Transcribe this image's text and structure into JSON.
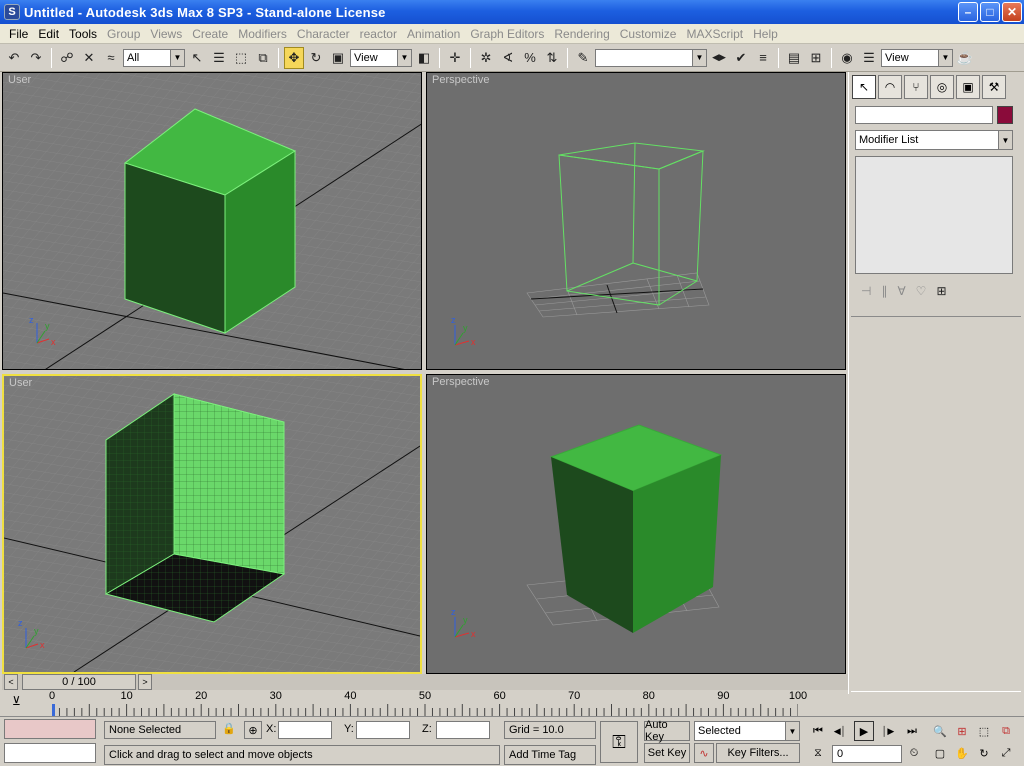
{
  "window": {
    "title": "Untitled  - Autodesk 3ds Max 8 SP3  - Stand-alone License",
    "app_icon": "3ds-max-icon",
    "minimize_glyph": "–",
    "maximize_glyph": "□",
    "close_glyph": "✕"
  },
  "menu": [
    {
      "label": "File",
      "dim": false
    },
    {
      "label": "Edit",
      "dim": false
    },
    {
      "label": "Tools",
      "dim": false
    },
    {
      "label": "Group",
      "dim": true
    },
    {
      "label": "Views",
      "dim": true
    },
    {
      "label": "Create",
      "dim": true
    },
    {
      "label": "Modifiers",
      "dim": true
    },
    {
      "label": "Character",
      "dim": true
    },
    {
      "label": "reactor",
      "dim": true
    },
    {
      "label": "Animation",
      "dim": true
    },
    {
      "label": "Graph Editors",
      "dim": true
    },
    {
      "label": "Rendering",
      "dim": true
    },
    {
      "label": "Customize",
      "dim": true
    },
    {
      "label": "MAXScript",
      "dim": true
    },
    {
      "label": "Help",
      "dim": true
    }
  ],
  "toolbar": {
    "undo_glyph": "↶",
    "redo_glyph": "↷",
    "link_glyph": "☍",
    "unlink_glyph": "✕",
    "bind_glyph": "≈",
    "selection_filter": "All",
    "select_glyph": "↖",
    "select_by_name_glyph": "☰",
    "region_glyph": "⬚",
    "window_crossing_glyph": "⧉",
    "move_glyph": "✥",
    "rotate_glyph": "↻",
    "scale_glyph": "▣",
    "reference_coord": "View",
    "pivot_glyph": "◧",
    "manipulate_glyph": "✛",
    "snap_glyph": "✲",
    "angle_snap_glyph": "∢",
    "percent_snap_glyph": "%",
    "spinner_snap_glyph": "⇅",
    "named_sets_glyph": "✎",
    "named_selection": "",
    "mirror_glyph": "◀▶",
    "align_glyph": "✔",
    "layers_glyph": "≡",
    "curve_editor_glyph": "▤",
    "schematic_glyph": "⊞",
    "material_editor_glyph": "◉",
    "render_scene_glyph": "☰",
    "render_type": "View",
    "quick_render_glyph": "☕"
  },
  "viewports": [
    {
      "label": "User"
    },
    {
      "label": "Perspective"
    },
    {
      "label": "User"
    },
    {
      "label": "Perspective"
    }
  ],
  "command_panel": {
    "tabs": [
      "↖",
      "◠",
      "⑂",
      "◎",
      "▣",
      "⚒"
    ],
    "modifier_list": "Modifier List",
    "stack_tools": [
      "⊣",
      "∥",
      "∀",
      "♡",
      "⊞"
    ]
  },
  "timeline": {
    "position": "0 / 100",
    "prev_glyph": "<",
    "next_glyph": ">",
    "ticks": [
      "0",
      "10",
      "20",
      "30",
      "40",
      "50",
      "60",
      "70",
      "80",
      "90",
      "100"
    ]
  },
  "status": {
    "selection": "None Selected",
    "lock_glyph": "🔒",
    "transform_mode_glyph": "⊕",
    "x_label": "X:",
    "y_label": "Y:",
    "z_label": "Z:",
    "grid": "Grid = 10.0",
    "prompt": "Click and drag to select and move objects",
    "add_time_tag": "Add Time Tag",
    "key_glyph": "⚿",
    "auto_key": "Auto Key",
    "set_key": "Set Key",
    "key_mode_glyph": "∿",
    "selected": "Selected",
    "key_filters": "Key Filters...",
    "frame": "0",
    "playback_glyphs": [
      "⏮",
      "◀│",
      "▶",
      "│▶",
      "⏭"
    ],
    "key_step_glyph": "⧖",
    "time_config_glyph": "⏲",
    "nav_glyphs": [
      "🔍",
      "⊞",
      "⬚",
      "⧉",
      "▢",
      "✋",
      "↻",
      "⤢"
    ]
  },
  "colors": {
    "active_border": "#f0e040",
    "box_green": "#3aa83a",
    "object_color": "#8a0b3a"
  }
}
